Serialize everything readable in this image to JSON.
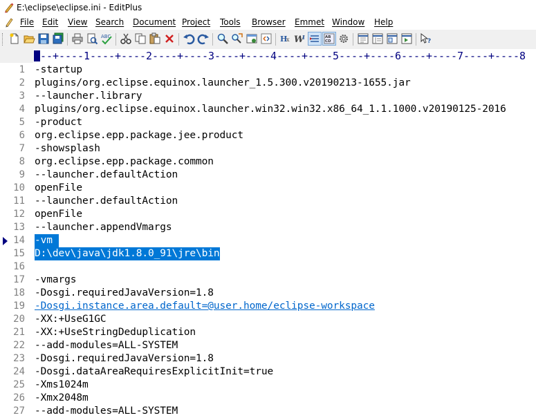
{
  "window": {
    "title": "E:\\eclipse\\eclipse.ini - EditPlus"
  },
  "menu": [
    {
      "label": "File"
    },
    {
      "label": "Edit"
    },
    {
      "label": "View"
    },
    {
      "label": "Search"
    },
    {
      "label": "Document"
    },
    {
      "label": "Project"
    },
    {
      "label": "Tools"
    },
    {
      "label": "Browser"
    },
    {
      "label": "Emmet"
    },
    {
      "label": "Window"
    },
    {
      "label": "Help"
    }
  ],
  "toolbar": {
    "buttons": [
      {
        "icon": "new-file-icon"
      },
      {
        "icon": "open-folder-icon"
      },
      {
        "icon": "save-icon"
      },
      {
        "icon": "save-all-icon"
      },
      {
        "icon": "print-icon"
      },
      {
        "icon": "print-preview-icon"
      },
      {
        "icon": "spell-check-icon"
      },
      {
        "icon": "cut-icon"
      },
      {
        "icon": "copy-icon"
      },
      {
        "icon": "paste-icon"
      },
      {
        "icon": "delete-icon"
      },
      {
        "icon": "undo-icon"
      },
      {
        "icon": "redo-icon"
      },
      {
        "icon": "find-icon"
      },
      {
        "icon": "replace-icon"
      },
      {
        "icon": "browser-icon"
      },
      {
        "icon": "html-toolbar-icon"
      },
      {
        "icon": "hex-viewer-icon"
      },
      {
        "icon": "word-wrap-icon"
      },
      {
        "icon": "line-number-icon"
      },
      {
        "icon": "spell-check-abc-icon"
      },
      {
        "icon": "settings-icon"
      },
      {
        "icon": "window-tile-icon"
      },
      {
        "icon": "window-list-icon"
      },
      {
        "icon": "cliptext-icon"
      },
      {
        "icon": "directory-icon"
      },
      {
        "icon": "context-help-icon"
      }
    ]
  },
  "ruler": {
    "text": "---+----1----+----2----+----3----+----4----+----5----+----6----+----7----+----8"
  },
  "editor": {
    "current_line": 14,
    "lines": [
      {
        "n": "1",
        "text": "-startup"
      },
      {
        "n": "2",
        "text": "plugins/org.eclipse.equinox.launcher_1.5.300.v20190213-1655.jar"
      },
      {
        "n": "3",
        "text": "--launcher.library"
      },
      {
        "n": "4",
        "text": "plugins/org.eclipse.equinox.launcher.win32.win32.x86_64_1.1.1000.v20190125-2016"
      },
      {
        "n": "5",
        "text": "-product"
      },
      {
        "n": "6",
        "text": "org.eclipse.epp.package.jee.product"
      },
      {
        "n": "7",
        "text": "-showsplash"
      },
      {
        "n": "8",
        "text": "org.eclipse.epp.package.common"
      },
      {
        "n": "9",
        "text": "--launcher.defaultAction"
      },
      {
        "n": "10",
        "text": "openFile"
      },
      {
        "n": "11",
        "text": "--launcher.defaultAction"
      },
      {
        "n": "12",
        "text": "openFile"
      },
      {
        "n": "13",
        "text": "--launcher.appendVmargs"
      },
      {
        "n": "14",
        "text": "-vm ",
        "selected": true
      },
      {
        "n": "15",
        "text": "D:\\dev\\java\\jdk1.8.0_91\\jre\\bin",
        "selected": true
      },
      {
        "n": "16",
        "text": ""
      },
      {
        "n": "17",
        "text": "-vmargs"
      },
      {
        "n": "18",
        "text": "-Dosgi.requiredJavaVersion=1.8"
      },
      {
        "n": "19",
        "text": "-Dosgi.instance.area.default=@user.home/eclipse-workspace",
        "link": true
      },
      {
        "n": "20",
        "text": "-XX:+UseG1GC"
      },
      {
        "n": "21",
        "text": "-XX:+UseStringDeduplication"
      },
      {
        "n": "22",
        "text": "--add-modules=ALL-SYSTEM"
      },
      {
        "n": "23",
        "text": "-Dosgi.requiredJavaVersion=1.8"
      },
      {
        "n": "24",
        "text": "-Dosgi.dataAreaRequiresExplicitInit=true"
      },
      {
        "n": "25",
        "text": "-Xms1024m"
      },
      {
        "n": "26",
        "text": "-Xmx2048m"
      },
      {
        "n": "27",
        "text": "--add-modules=ALL-SYSTEM"
      }
    ]
  },
  "colors": {
    "selection": "#0078d7",
    "line_number": "#808080",
    "link": "#0066cc",
    "ruler": "#000080"
  }
}
